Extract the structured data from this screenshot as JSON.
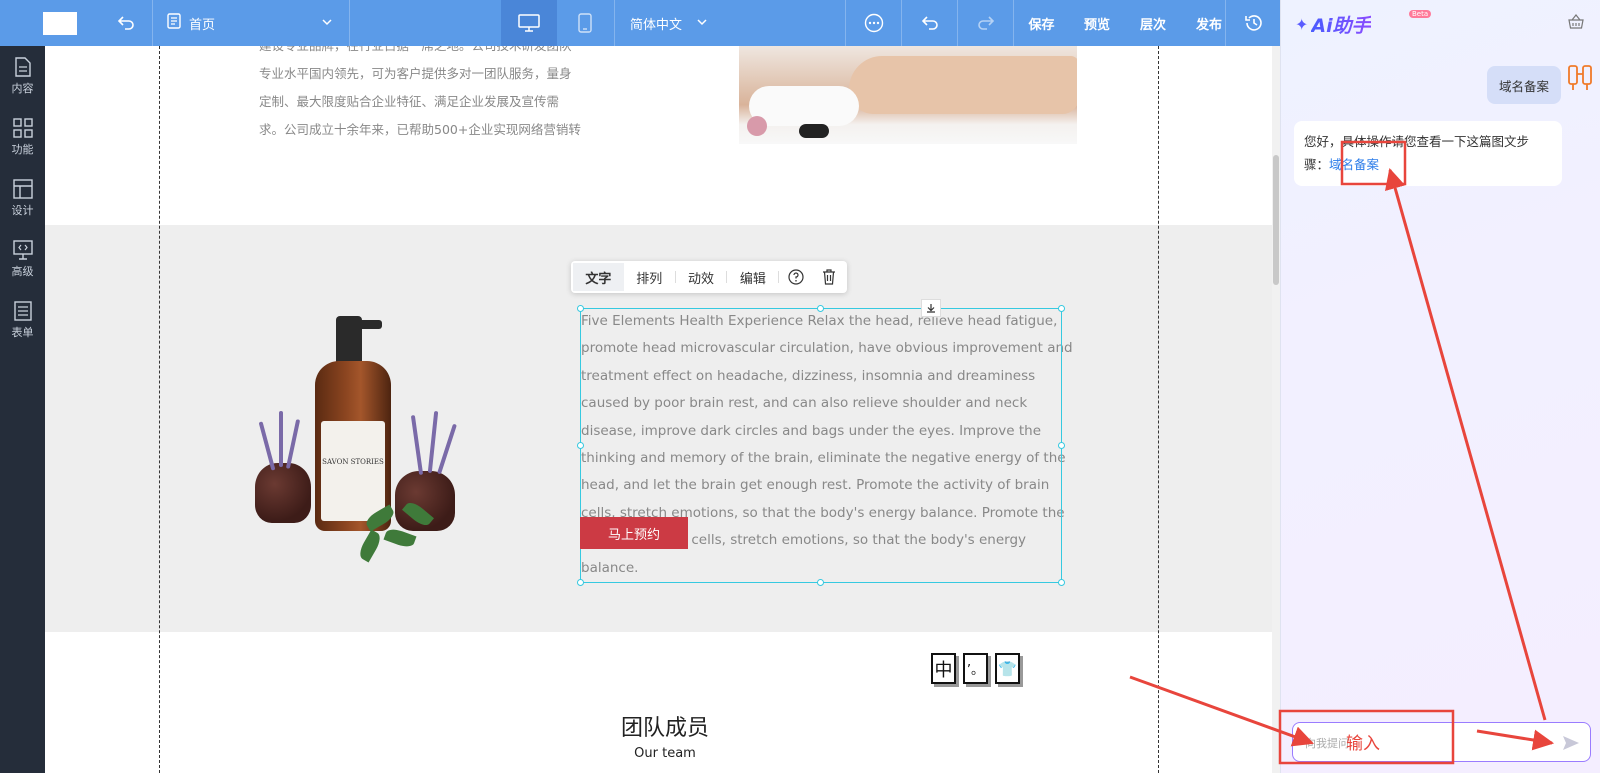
{
  "toolbar": {
    "page_name": "首页",
    "language": "简体中文",
    "save": "保存",
    "preview": "预览",
    "layers": "层次",
    "publish": "发布"
  },
  "sidebar": {
    "items": [
      {
        "label": "内容",
        "icon": "document-icon"
      },
      {
        "label": "功能",
        "icon": "grid-icon"
      },
      {
        "label": "设计",
        "icon": "layout-icon"
      },
      {
        "label": "高级",
        "icon": "code-monitor-icon"
      },
      {
        "label": "表单",
        "icon": "form-icon"
      }
    ]
  },
  "canvas": {
    "intro_lines": [
      "建设专业品牌，在行业占据一席之地。公司技术研发团队",
      "专业水平国内领先，可为客户提供多对一团队服务，量身",
      "定制、最大限度贴合企业特征、满足企业发展及宣传需",
      "求。公司成立十余年来，已帮助500+企业实现网络营销转"
    ],
    "bottle_label": "SAVON STORIES",
    "description_lines": [
      "Five Elements Health Experience Relax the head, relieve head fatigue,",
      "promote head microvascular circulation, have obvious improvement and",
      "treatment effect on headache, dizziness, insomnia and dreaminess",
      "caused by poor brain rest, and can also relieve shoulder and neck",
      "disease, improve dark circles and bags under the eyes. Improve the",
      "thinking and memory of the brain, eliminate the negative energy of the",
      "head, and let the brain get enough rest. Promote the activity of brain",
      "cells, stretch emotions, so that the body's energy balance. Promote the",
      "activity of brain cells, stretch emotions, so that the body's energy",
      "balance."
    ],
    "cta_button": "马上预约",
    "float_toolbar": {
      "text": "文字",
      "arrange": "排列",
      "animation": "动效",
      "edit": "编辑"
    },
    "small_icons": [
      "中",
      "’。",
      "👕"
    ],
    "team_title": "团队成员",
    "team_subtitle": "Our team"
  },
  "ai_panel": {
    "title": "Ai助手",
    "beta": "Beta",
    "user_message": "域名备案",
    "bot_message_prefix": "您好，具体操作请您查看一下这篇图文步骤：",
    "bot_message_link": "域名备案",
    "input_placeholder": "向我提问",
    "annotation_label": "输入"
  },
  "colors": {
    "toolbar": "#5b9be8",
    "sidebar": "#252d3a",
    "cta": "#cc3a44",
    "selection": "#36c9e0",
    "annotation": "#e8453c",
    "link": "#2b7ce9"
  }
}
